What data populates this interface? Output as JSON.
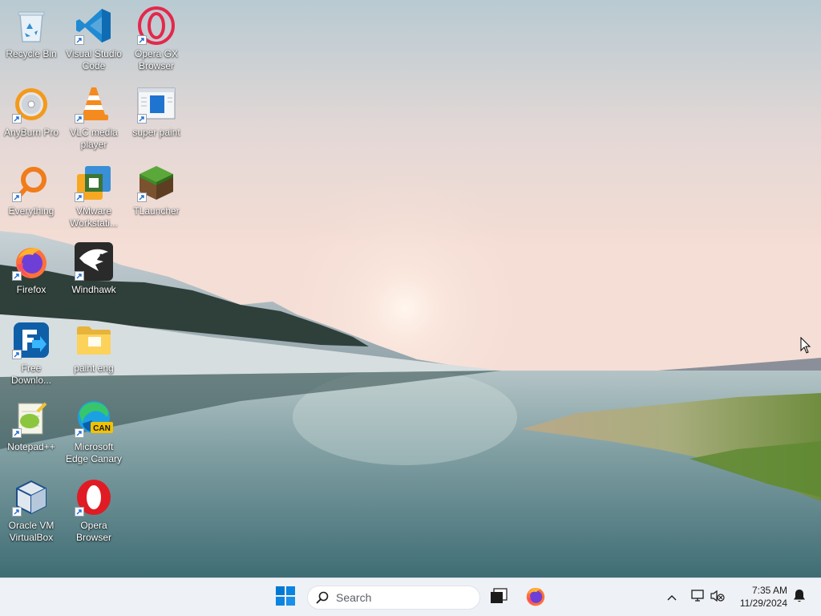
{
  "desktop": {
    "icons": [
      {
        "label": "Recycle Bin",
        "icon": "recycle-bin-icon",
        "shortcut": false
      },
      {
        "label": "Visual Studio Code",
        "icon": "vscode-icon",
        "shortcut": true
      },
      {
        "label": "Opera GX Browser",
        "icon": "opera-gx-icon",
        "shortcut": true
      },
      {
        "label": "AnyBurn Pro",
        "icon": "anyburn-disc-icon",
        "shortcut": true
      },
      {
        "label": "VLC media player",
        "icon": "vlc-cone-icon",
        "shortcut": true
      },
      {
        "label": "super paint",
        "icon": "super-paint-icon",
        "shortcut": true
      },
      {
        "label": "Everything",
        "icon": "everything-search-icon",
        "shortcut": true
      },
      {
        "label": "VMware Workstati...",
        "icon": "vmware-icon",
        "shortcut": true
      },
      {
        "label": "TLauncher",
        "icon": "tlauncher-block-icon",
        "shortcut": true
      },
      {
        "label": "Firefox",
        "icon": "firefox-icon",
        "shortcut": true
      },
      {
        "label": "Windhawk",
        "icon": "windhawk-icon",
        "shortcut": true
      },
      {
        "label": "Free Downlo...",
        "icon": "free-download-manager-icon",
        "shortcut": true
      },
      {
        "label": "paint eng",
        "icon": "folder-icon",
        "shortcut": false
      },
      {
        "label": "Notepad++",
        "icon": "notepadpp-icon",
        "shortcut": true
      },
      {
        "label": "Microsoft Edge Canary",
        "icon": "edge-canary-icon",
        "shortcut": true
      },
      {
        "label": "Oracle VM VirtualBox",
        "icon": "virtualbox-icon",
        "shortcut": true
      },
      {
        "label": "Opera Browser",
        "icon": "opera-icon",
        "shortcut": true
      }
    ],
    "edge_badge": "CAN"
  },
  "taskbar": {
    "start_icon": "windows-start-icon",
    "search_placeholder": "Search",
    "pinned": [
      {
        "icon": "task-view-icon"
      },
      {
        "icon": "firefox-icon"
      }
    ],
    "tray": {
      "chevron_icon": "chevron-up-icon",
      "network_icon": "network-icon",
      "volume_icon": "volume-muted-icon",
      "time": "7:35 AM",
      "date": "11/29/2024",
      "notification_icon": "bell-icon"
    }
  },
  "colors": {
    "accent": "#0078d4",
    "taskbar_bg": "#eef1f5"
  }
}
